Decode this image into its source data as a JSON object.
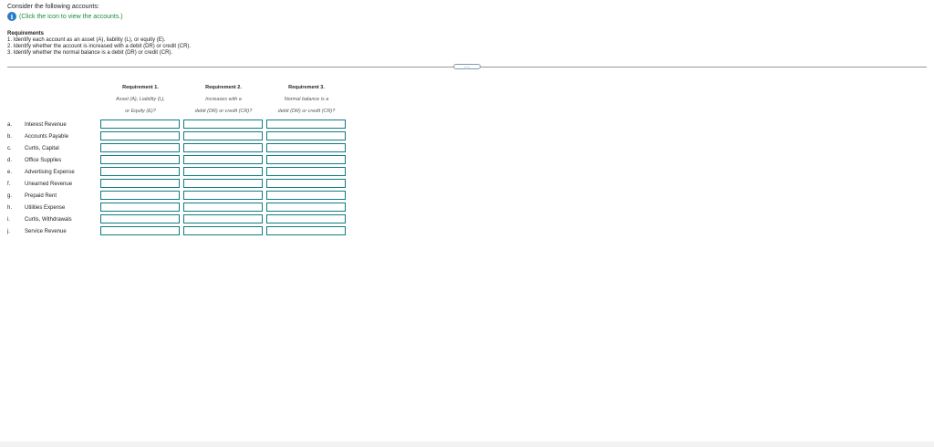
{
  "intro": "Consider the following accounts:",
  "hint": "(Click the icon to view the accounts.)",
  "info_icon": "info-icon",
  "requirements": {
    "heading": "Requirements",
    "items": [
      "1. Identify each account as an asset (A), liability (L), or equity (E).",
      "2. Identify whether the account is increased with a debit (DR) or credit (CR).",
      "3. Identify whether the normal balance is a debit (DR) or credit (CR)."
    ]
  },
  "expand_handle": ".....",
  "columns": [
    {
      "title": "Requirement 1.",
      "sub": [
        "Asset (A), Liability (L),",
        "or Equity (E)?"
      ]
    },
    {
      "title": "Requirement 2.",
      "sub": [
        "Increases with a",
        "debit (DR) or credit (CR)?"
      ]
    },
    {
      "title": "Requirement 3.",
      "sub": [
        "Normal balance is a",
        "debit (DR) or credit (CR)?"
      ]
    }
  ],
  "accounts": [
    {
      "letter": "a.",
      "name": "Interest Revenue"
    },
    {
      "letter": "b.",
      "name": "Accounts Payable"
    },
    {
      "letter": "c.",
      "name": "Curtis, Capital"
    },
    {
      "letter": "d.",
      "name": "Office Supplies"
    },
    {
      "letter": "e.",
      "name": "Advertising Expense"
    },
    {
      "letter": "f.",
      "name": "Unearned Revenue"
    },
    {
      "letter": "g.",
      "name": "Prepaid Rent"
    },
    {
      "letter": "h.",
      "name": "Utilities Expense"
    },
    {
      "letter": "i.",
      "name": "Curtis, Withdrawals"
    },
    {
      "letter": "j.",
      "name": "Service Revenue"
    }
  ],
  "colors": {
    "hint": "#1a8a3a",
    "info": "#2b7bc6",
    "cell_border": "#0e7c83"
  }
}
